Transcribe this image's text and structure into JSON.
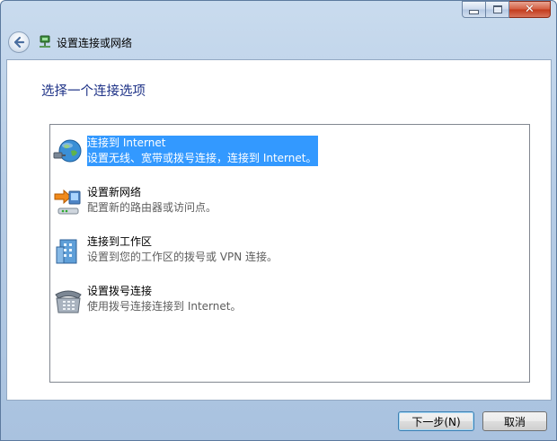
{
  "window": {
    "title": "设置连接或网络",
    "controls": {
      "minimize": "minimize",
      "maximize": "maximize",
      "close": "✕"
    }
  },
  "heading": "选择一个连接选项",
  "options": [
    {
      "title": "连接到 Internet",
      "description": "设置无线、宽带或拨号连接，连接到 Internet。",
      "icon": "globe-network-icon",
      "selected": true
    },
    {
      "title": "设置新网络",
      "description": "配置新的路由器或访问点。",
      "icon": "router-setup-icon",
      "selected": false
    },
    {
      "title": "连接到工作区",
      "description": "设置到您的工作区的拨号或 VPN 连接。",
      "icon": "workplace-building-icon",
      "selected": false
    },
    {
      "title": "设置拨号连接",
      "description": "使用拨号连接连接到 Internet。",
      "icon": "dialup-phone-icon",
      "selected": false
    }
  ],
  "buttons": {
    "next": "下一步(N)",
    "cancel": "取消"
  },
  "colors": {
    "selection": "#3399ff",
    "heading": "#1e3287",
    "description": "#5d5d5d"
  }
}
